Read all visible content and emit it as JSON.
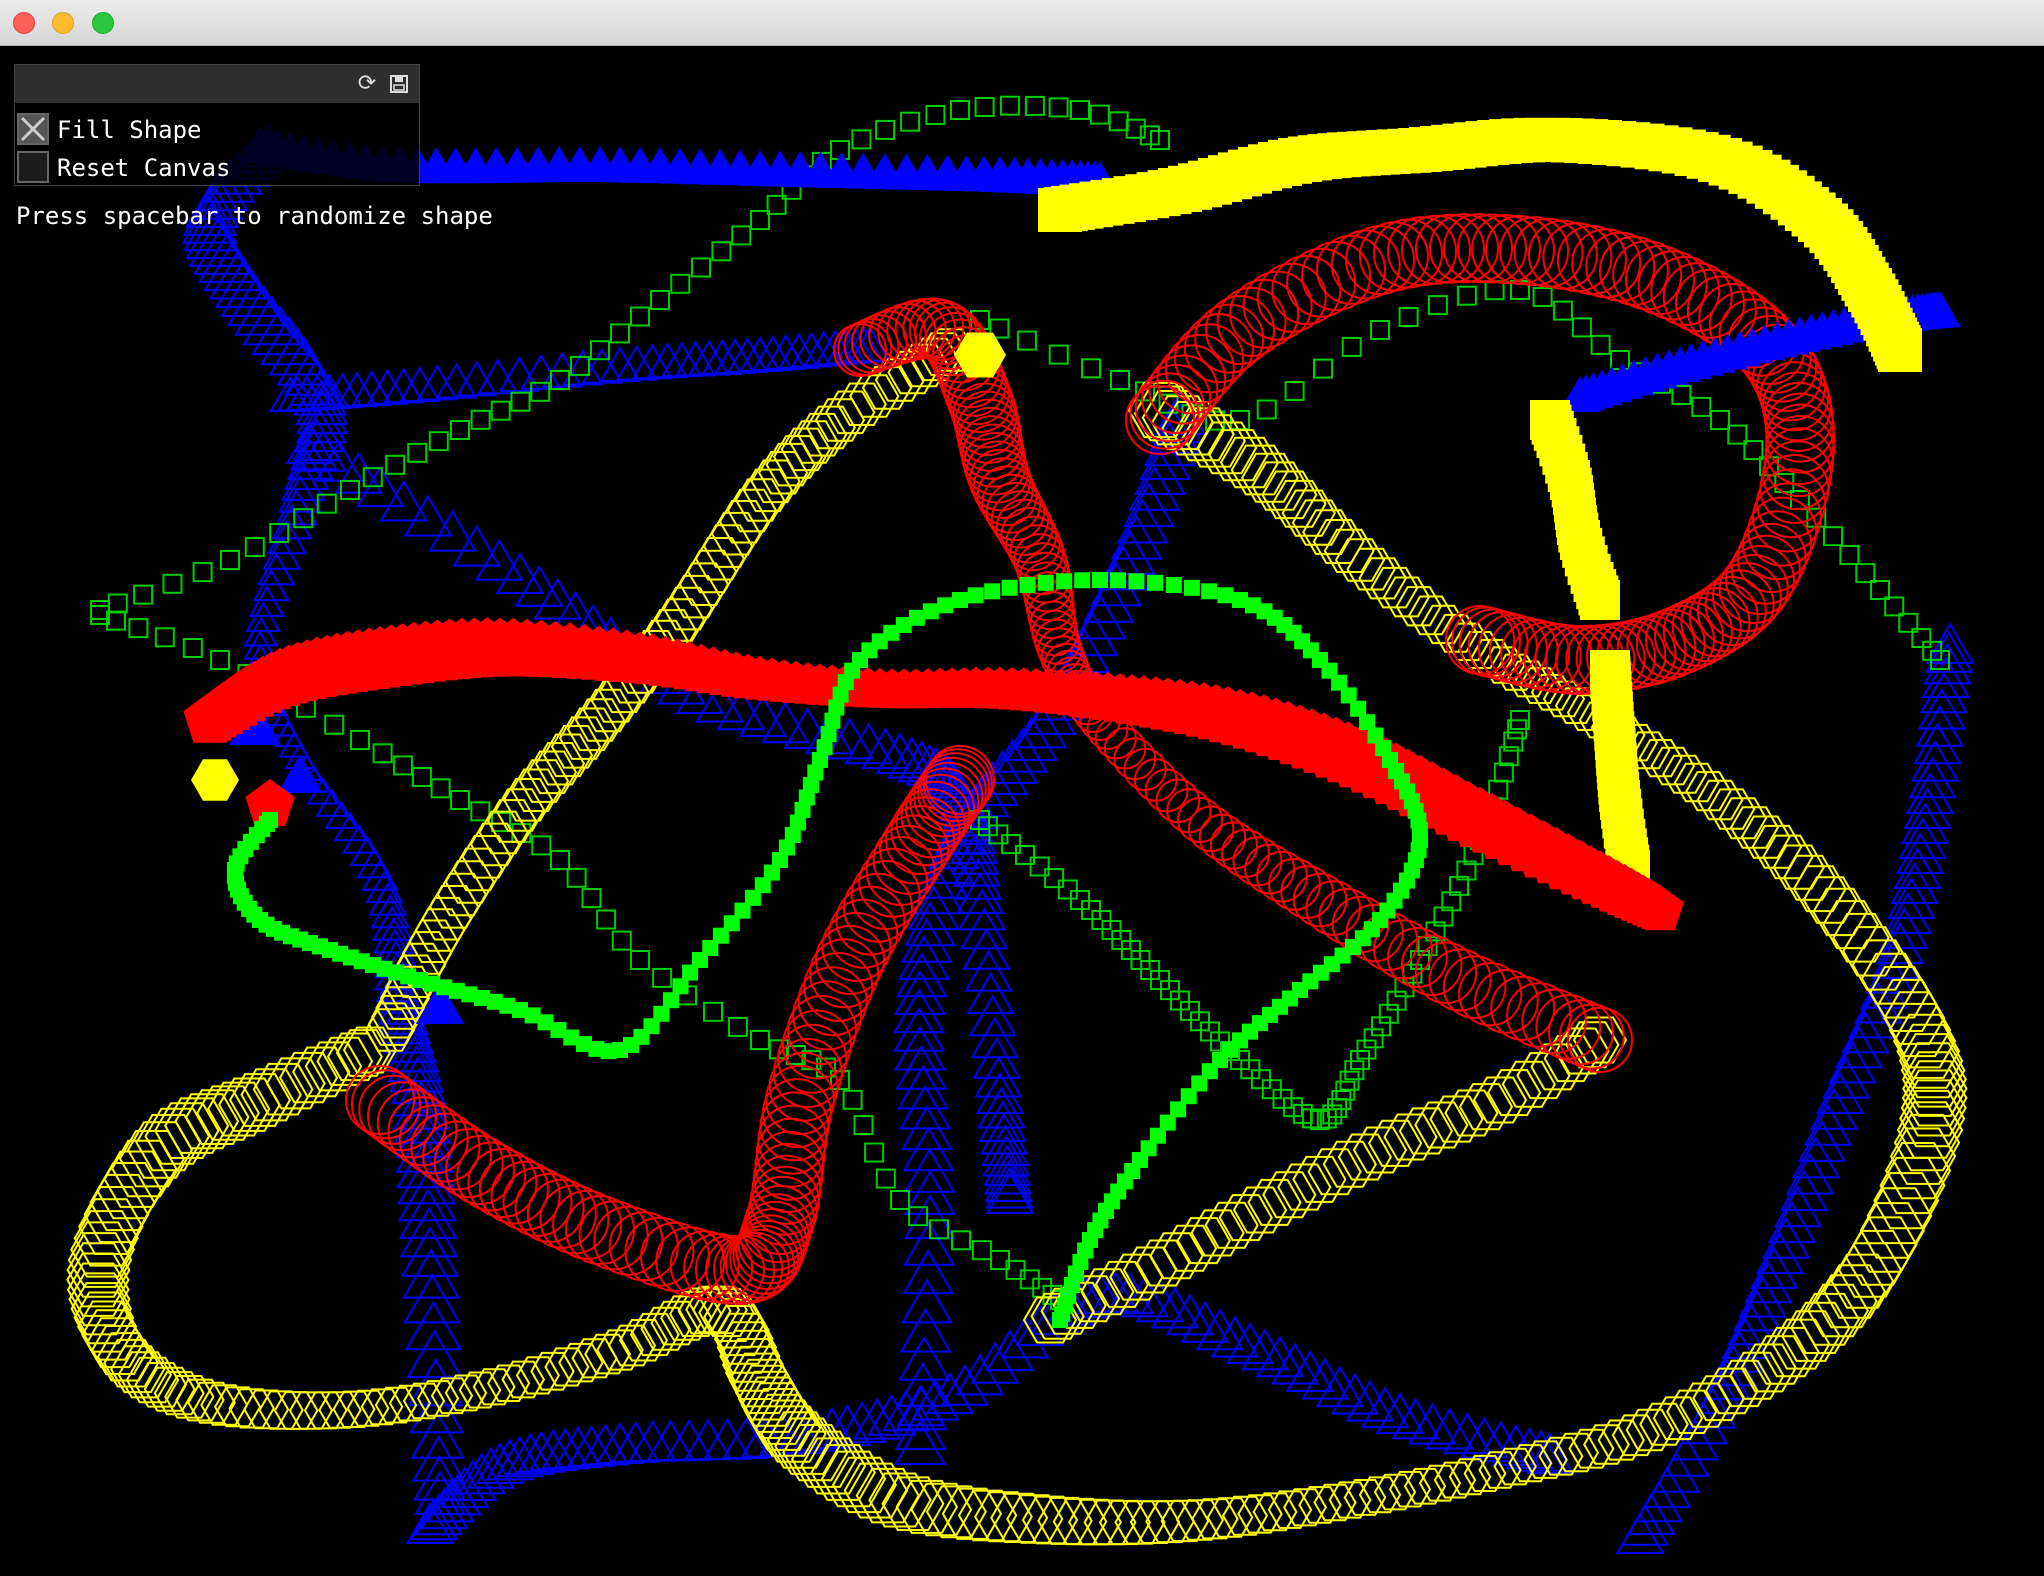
{
  "window": {
    "controls": [
      "close",
      "minimize",
      "zoom"
    ]
  },
  "gui": {
    "header_icons": [
      "refresh-icon",
      "save-icon"
    ],
    "fill_shape": {
      "label": "Fill Shape",
      "checked": true
    },
    "reset_canvas": {
      "label": "Reset Canvas",
      "checked": false
    }
  },
  "hint": "Press spacebar to randomize shape",
  "colors": {
    "background": "#000000",
    "red": "#ff0000",
    "green": "#00ff00",
    "blue": "#0000ff",
    "yellow": "#ffff00"
  }
}
